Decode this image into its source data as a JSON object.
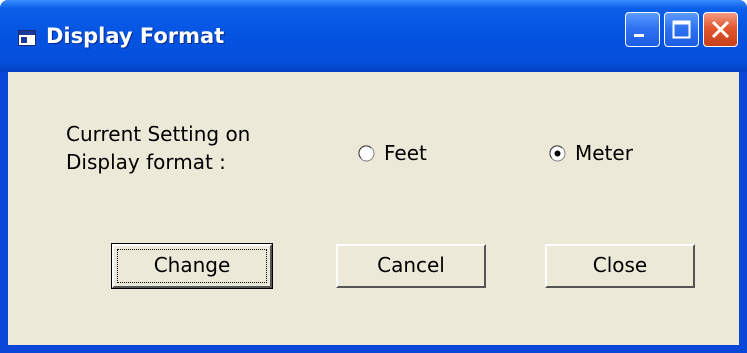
{
  "window": {
    "title": "Display Format",
    "title_icon": "app-window-icon",
    "controls": {
      "minimize_icon": "minimize-icon",
      "maximize_icon": "maximize-icon",
      "close_icon": "close-icon"
    }
  },
  "form": {
    "setting_label_line1": "Current Setting on",
    "setting_label_line2": "Display format :",
    "options": [
      {
        "label": "Feet",
        "selected": false
      },
      {
        "label": "Meter",
        "selected": true
      }
    ]
  },
  "buttons": {
    "change": "Change",
    "cancel": "Cancel",
    "close": "Close"
  },
  "colors": {
    "title_bar": "#0553e1",
    "client_background": "#ece9d8",
    "close_button": "#e2582f"
  }
}
